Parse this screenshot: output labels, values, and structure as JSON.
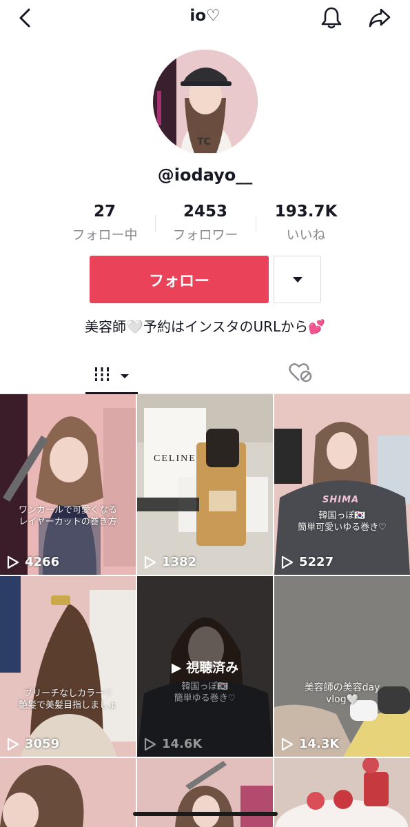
{
  "header": {
    "title": "io♡"
  },
  "profile": {
    "username": "@iodayo__"
  },
  "stats": [
    {
      "value": "27",
      "label": "フォロー中"
    },
    {
      "value": "2453",
      "label": "フォロワー"
    },
    {
      "value": "193.7K",
      "label": "いいね"
    }
  ],
  "actions": {
    "follow_label": "フォロー"
  },
  "bio": "美容師🤍予約はインスタのURLから💕",
  "videos": [
    {
      "views": "4266",
      "caption": [
        "ワンカールで可愛くなる",
        "レイヤーカットの巻き方"
      ]
    },
    {
      "views": "1382",
      "caption": [],
      "brand": "CELINE"
    },
    {
      "views": "5227",
      "caption": [
        "韓国っぽ🇰🇷",
        "簡単可愛いゆる巻き♡"
      ],
      "cape_text": "SHIMA"
    },
    {
      "views": "3059",
      "caption": [
        "ブリーチなしカラー♡",
        "艶髪で美髪目指しましょ"
      ]
    },
    {
      "views": "14.6K",
      "caption": [
        "韓国っぽ🇰🇷",
        "簡単ゆる巻き♡"
      ],
      "watched": "▶ 視聴済み"
    },
    {
      "views": "14.3K",
      "caption": [
        "美容師の美容day",
        "vlog🤍"
      ]
    }
  ],
  "colors": {
    "accent": "#ea4359",
    "text": "#161823",
    "muted": "#8a8b91"
  }
}
